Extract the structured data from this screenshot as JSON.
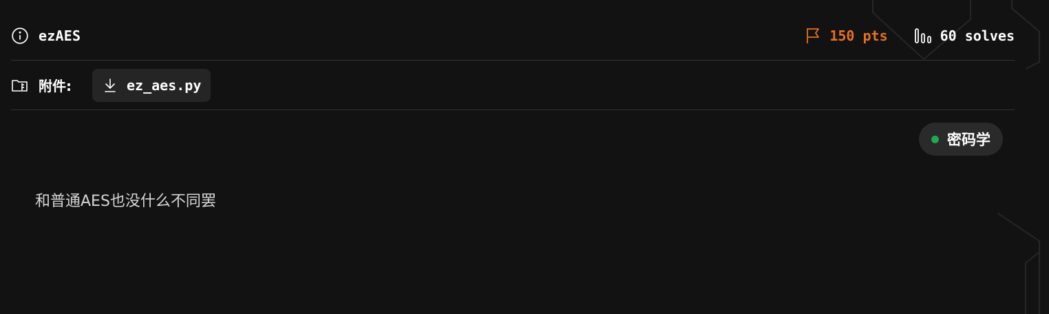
{
  "challenge": {
    "title": "ezAES",
    "points": "150 pts",
    "solves": "60 solves"
  },
  "attachments": {
    "label": "附件:",
    "file_name": "ez_aes.py"
  },
  "tag": {
    "label": "密码学",
    "dot_color": "#1faa4f"
  },
  "description": "和普通AES也没什么不同罢",
  "colors": {
    "background": "#121212",
    "points": "#e8701f",
    "divider": "#343434",
    "chip_bg": "#252525"
  },
  "icons": {
    "title": "info-icon",
    "points": "flag-icon",
    "solves": "bar-chart-icon",
    "attachments": "folder-icon",
    "file": "download-icon"
  }
}
